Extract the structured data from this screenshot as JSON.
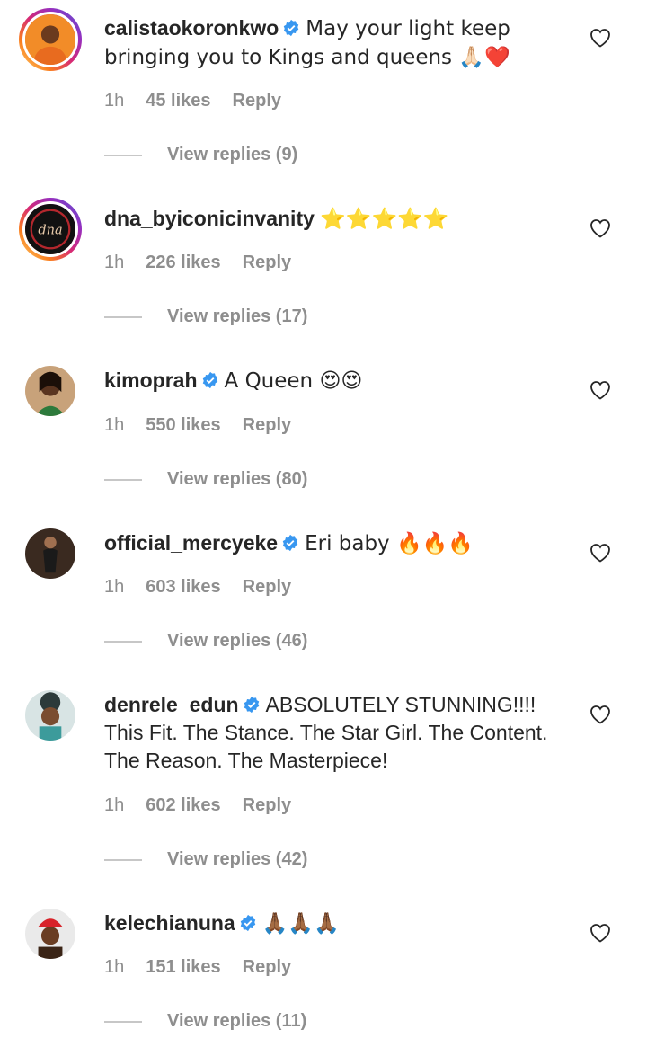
{
  "comments": [
    {
      "username": "calistaokoronkwo",
      "verified": true,
      "text": "May your light keep bringing you to Kings and queens 🙏🏻❤️",
      "time": "1h",
      "likes": "45 likes",
      "reply": "Reply",
      "view_replies": "View replies (9)"
    },
    {
      "username": "dna_byiconicinvanity",
      "verified": false,
      "text": "⭐⭐⭐⭐⭐",
      "time": "1h",
      "likes": "226 likes",
      "reply": "Reply",
      "view_replies": "View replies (17)"
    },
    {
      "username": "kimoprah",
      "verified": true,
      "text": "A Queen 😍😍",
      "time": "1h",
      "likes": "550 likes",
      "reply": "Reply",
      "view_replies": "View replies (80)"
    },
    {
      "username": "official_mercyeke",
      "verified": true,
      "text": "Eri baby 🔥🔥🔥",
      "time": "1h",
      "likes": "603 likes",
      "reply": "Reply",
      "view_replies": "View replies (46)"
    },
    {
      "username": "denrele_edun",
      "verified": true,
      "text": "ABSOLUTELY STUNNING!!!! This Fit. The Stance. The Star Girl. The Content. The Reason. The Masterpiece!",
      "time": "1h",
      "likes": "602 likes",
      "reply": "Reply",
      "view_replies": "View replies (42)"
    },
    {
      "username": "kelechianuna",
      "verified": true,
      "text": "🙏🏾🙏🏾🙏🏾",
      "time": "1h",
      "likes": "151 likes",
      "reply": "Reply",
      "view_replies": "View replies (11)"
    }
  ],
  "icons": {
    "verified": "verified-badge-icon",
    "like": "heart-outline-icon"
  },
  "colors": {
    "verified_blue": "#3897f0",
    "meta_gray": "#8e8e8e",
    "text": "#262626"
  }
}
